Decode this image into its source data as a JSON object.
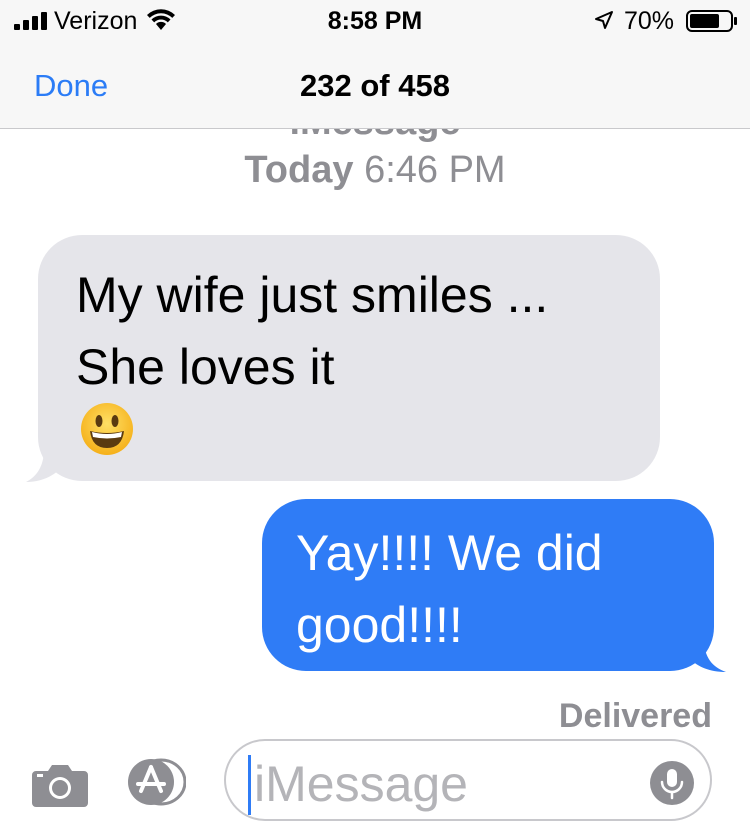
{
  "status_bar": {
    "carrier": "Verizon",
    "time": "8:58 PM",
    "battery_percent": "70%"
  },
  "nav": {
    "done_label": "Done",
    "title": "232 of 458"
  },
  "thread": {
    "service_label": "iMessage",
    "timestamp_day": "Today",
    "timestamp_time": "6:46 PM",
    "messages": [
      {
        "direction": "incoming",
        "text": "My wife just smiles ... She loves it",
        "emoji": "grinning-face"
      },
      {
        "direction": "outgoing",
        "text": "Yay!!!! We did good!!!!"
      }
    ],
    "delivery_status": "Delivered"
  },
  "input": {
    "placeholder": "iMessage"
  },
  "colors": {
    "accent": "#2b7cf6",
    "outgoing_bubble": "#2f7cf6",
    "incoming_bubble": "#e5e5ea",
    "secondary_text": "#8e8e93"
  },
  "icons": [
    "signal-bars-icon",
    "wifi-icon",
    "location-arrow-icon",
    "battery-icon",
    "camera-icon",
    "app-store-icon",
    "microphone-icon"
  ]
}
